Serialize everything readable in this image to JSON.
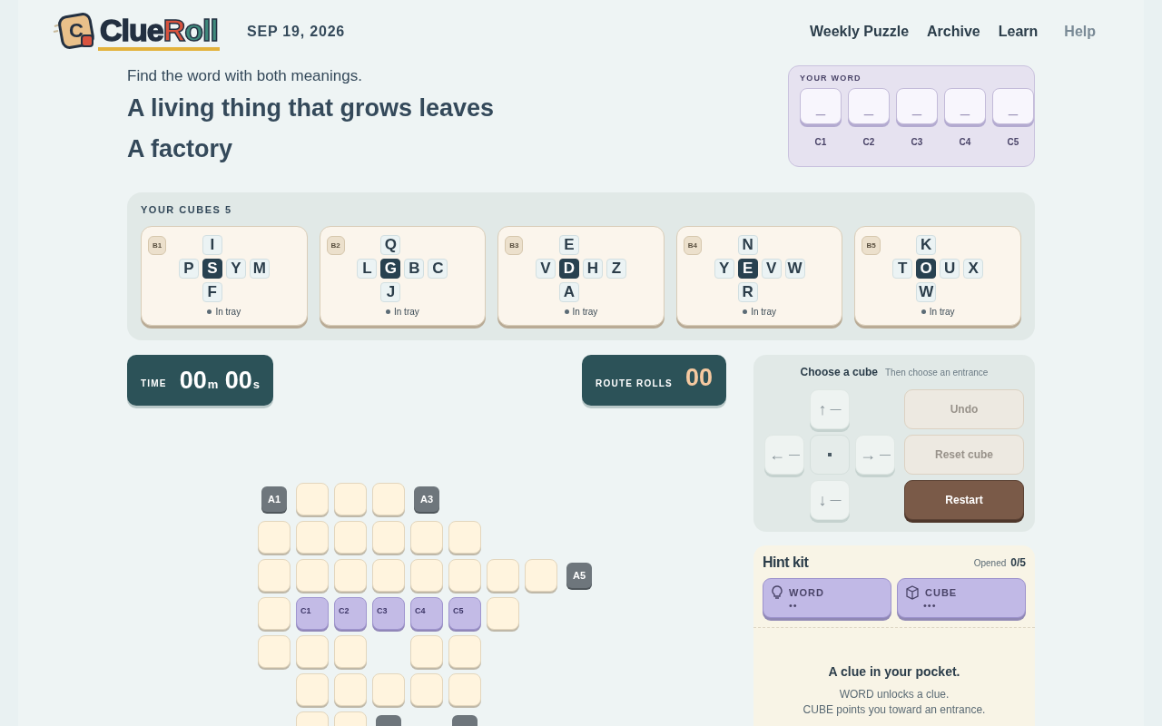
{
  "header": {
    "logo": {
      "cube_letter": "C",
      "word_1": "Clue",
      "word_2_first": "R",
      "word_2_rest": "oll"
    },
    "date": "SEP 19, 2026",
    "nav": [
      {
        "label": "Weekly Puzzle",
        "muted": false
      },
      {
        "label": "Archive",
        "muted": false
      },
      {
        "label": "Learn",
        "muted": false
      },
      {
        "label": "Help",
        "muted": true
      }
    ]
  },
  "prompt": {
    "instruction": "Find the word with both meanings.",
    "clues": [
      "A living thing that grows leaves",
      "A factory"
    ]
  },
  "word": {
    "title": "YOUR WORD",
    "slots": [
      {
        "value": "_",
        "label": "C1"
      },
      {
        "value": "_",
        "label": "C2"
      },
      {
        "value": "_",
        "label": "C3"
      },
      {
        "value": "_",
        "label": "C4"
      },
      {
        "value": "_",
        "label": "C5"
      }
    ]
  },
  "cubes": {
    "title": "YOUR CUBES 5",
    "items": [
      {
        "id": "B1",
        "top": "I",
        "left": "P",
        "center": "S",
        "right": [
          "Y",
          "M"
        ],
        "bottom": "F",
        "status": "In tray"
      },
      {
        "id": "B2",
        "top": "Q",
        "left": "L",
        "center": "G",
        "right": [
          "B",
          "C"
        ],
        "bottom": "J",
        "status": "In tray"
      },
      {
        "id": "B3",
        "top": "E",
        "left": "V",
        "center": "D",
        "right": [
          "H",
          "Z"
        ],
        "bottom": "A",
        "status": "In tray"
      },
      {
        "id": "B4",
        "top": "N",
        "left": "Y",
        "center": "E",
        "right": [
          "V",
          "W"
        ],
        "bottom": "R",
        "status": "In tray"
      },
      {
        "id": "B5",
        "top": "K",
        "left": "T",
        "center": "O",
        "right": [
          "U",
          "X"
        ],
        "bottom": "W",
        "status": "In tray"
      }
    ]
  },
  "timer": {
    "label": "TIME",
    "minutes": "00",
    "minutes_unit": "m",
    "seconds": "00",
    "seconds_unit": "s"
  },
  "rolls": {
    "label": "ROUTE ROLLS",
    "value": "00"
  },
  "controls": {
    "title": "Choose a cube",
    "subtitle": "Then choose an entrance",
    "pad": [
      {
        "kind": "up",
        "arrow": "↑",
        "value": "—"
      },
      {
        "kind": "left",
        "arrow": "←",
        "value": "—"
      },
      {
        "kind": "center"
      },
      {
        "kind": "right",
        "arrow": "→",
        "value": "—"
      },
      {
        "kind": "down",
        "arrow": "↓",
        "value": "—"
      }
    ],
    "buttons": [
      {
        "label": "Undo",
        "disabled": true
      },
      {
        "label": "Reset cube",
        "disabled": true
      },
      {
        "label": "Restart",
        "disabled": false
      }
    ]
  },
  "hints": {
    "title": "Hint kit",
    "opened_label": "Opened",
    "opened": "0/5",
    "kinds": [
      {
        "kind": "word",
        "label": "WORD",
        "dots": "••"
      },
      {
        "kind": "cube",
        "label": "CUBE",
        "dots": "•••"
      }
    ],
    "message": {
      "title": "A clue in your pocket.",
      "lines": [
        "WORD unlocks a clue.",
        "CUBE points you toward an entrance."
      ]
    }
  },
  "board": {
    "rows": [
      [
        {
          "kind": "entrance",
          "label": "A1"
        },
        {
          "kind": "tile"
        },
        {
          "kind": "tile"
        },
        {
          "kind": "tile"
        },
        {
          "kind": "entrance",
          "label": "A3"
        }
      ],
      [
        {
          "kind": "tile"
        },
        {
          "kind": "tile"
        },
        {
          "kind": "tile"
        },
        {
          "kind": "tile"
        },
        {
          "kind": "tile"
        },
        {
          "kind": "tile"
        }
      ],
      [
        {
          "kind": "tile"
        },
        {
          "kind": "tile"
        },
        {
          "kind": "tile"
        },
        {
          "kind": "tile"
        },
        {
          "kind": "tile"
        },
        {
          "kind": "tile"
        },
        {
          "kind": "tile"
        },
        {
          "kind": "tile"
        },
        {
          "kind": "entrance",
          "label": "A5"
        }
      ],
      [
        {
          "kind": "tile"
        },
        {
          "kind": "target",
          "label": "C1"
        },
        {
          "kind": "target",
          "label": "C2"
        },
        {
          "kind": "target",
          "label": "C3"
        },
        {
          "kind": "target",
          "label": "C4"
        },
        {
          "kind": "target",
          "label": "C5"
        },
        {
          "kind": "tile"
        }
      ],
      [
        {
          "kind": "tile"
        },
        {
          "kind": "tile"
        },
        {
          "kind": "tile"
        },
        {
          "kind": "empty"
        },
        {
          "kind": "tile"
        },
        {
          "kind": "tile"
        }
      ],
      [
        {
          "kind": "empty"
        },
        {
          "kind": "tile"
        },
        {
          "kind": "tile"
        },
        {
          "kind": "tile"
        },
        {
          "kind": "tile"
        },
        {
          "kind": "tile"
        }
      ],
      [
        {
          "kind": "empty"
        },
        {
          "kind": "tile"
        },
        {
          "kind": "tile"
        },
        {
          "kind": "entrance"
        },
        {
          "kind": "empty"
        },
        {
          "kind": "entrance"
        }
      ]
    ]
  }
}
